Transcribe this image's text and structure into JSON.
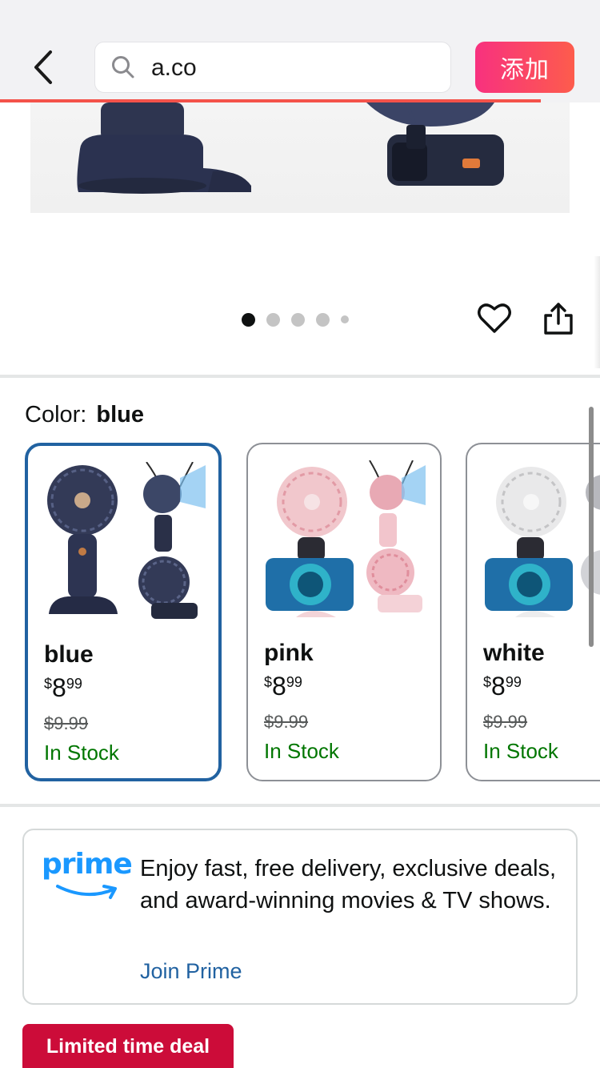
{
  "browser": {
    "url": "a.co",
    "add_button_label": "添加",
    "load_progress": 0.9
  },
  "gallery": {
    "image_count": 5,
    "active_index": 0
  },
  "color_section": {
    "label": "Color:",
    "selected_value": "blue"
  },
  "variants": [
    {
      "name": "blue",
      "currency": "$",
      "price_whole": "8",
      "price_cents": "99",
      "was_price": "$9.99",
      "stock": "In Stock",
      "selected": true
    },
    {
      "name": "pink",
      "currency": "$",
      "price_whole": "8",
      "price_cents": "99",
      "was_price": "$9.99",
      "stock": "In Stock",
      "selected": false
    },
    {
      "name": "white",
      "currency": "$",
      "price_whole": "8",
      "price_cents": "99",
      "was_price": "$9.99",
      "stock": "In Stock",
      "selected": false
    }
  ],
  "prime": {
    "logo_text": "prime",
    "description": "Enjoy fast, free delivery, exclusive deals, and award-winning movies & TV shows.",
    "link": "Join Prime"
  },
  "deal_badge": "Limited time deal",
  "colors": {
    "add_button_gradient_start": "#f8317f",
    "add_button_gradient_end": "#fd5c4c",
    "selected_border": "#2162a1",
    "stock_green": "#007600",
    "link_blue": "#2162a1",
    "deal_red": "#cc0c39",
    "prime_blue": "#1a98ff"
  }
}
